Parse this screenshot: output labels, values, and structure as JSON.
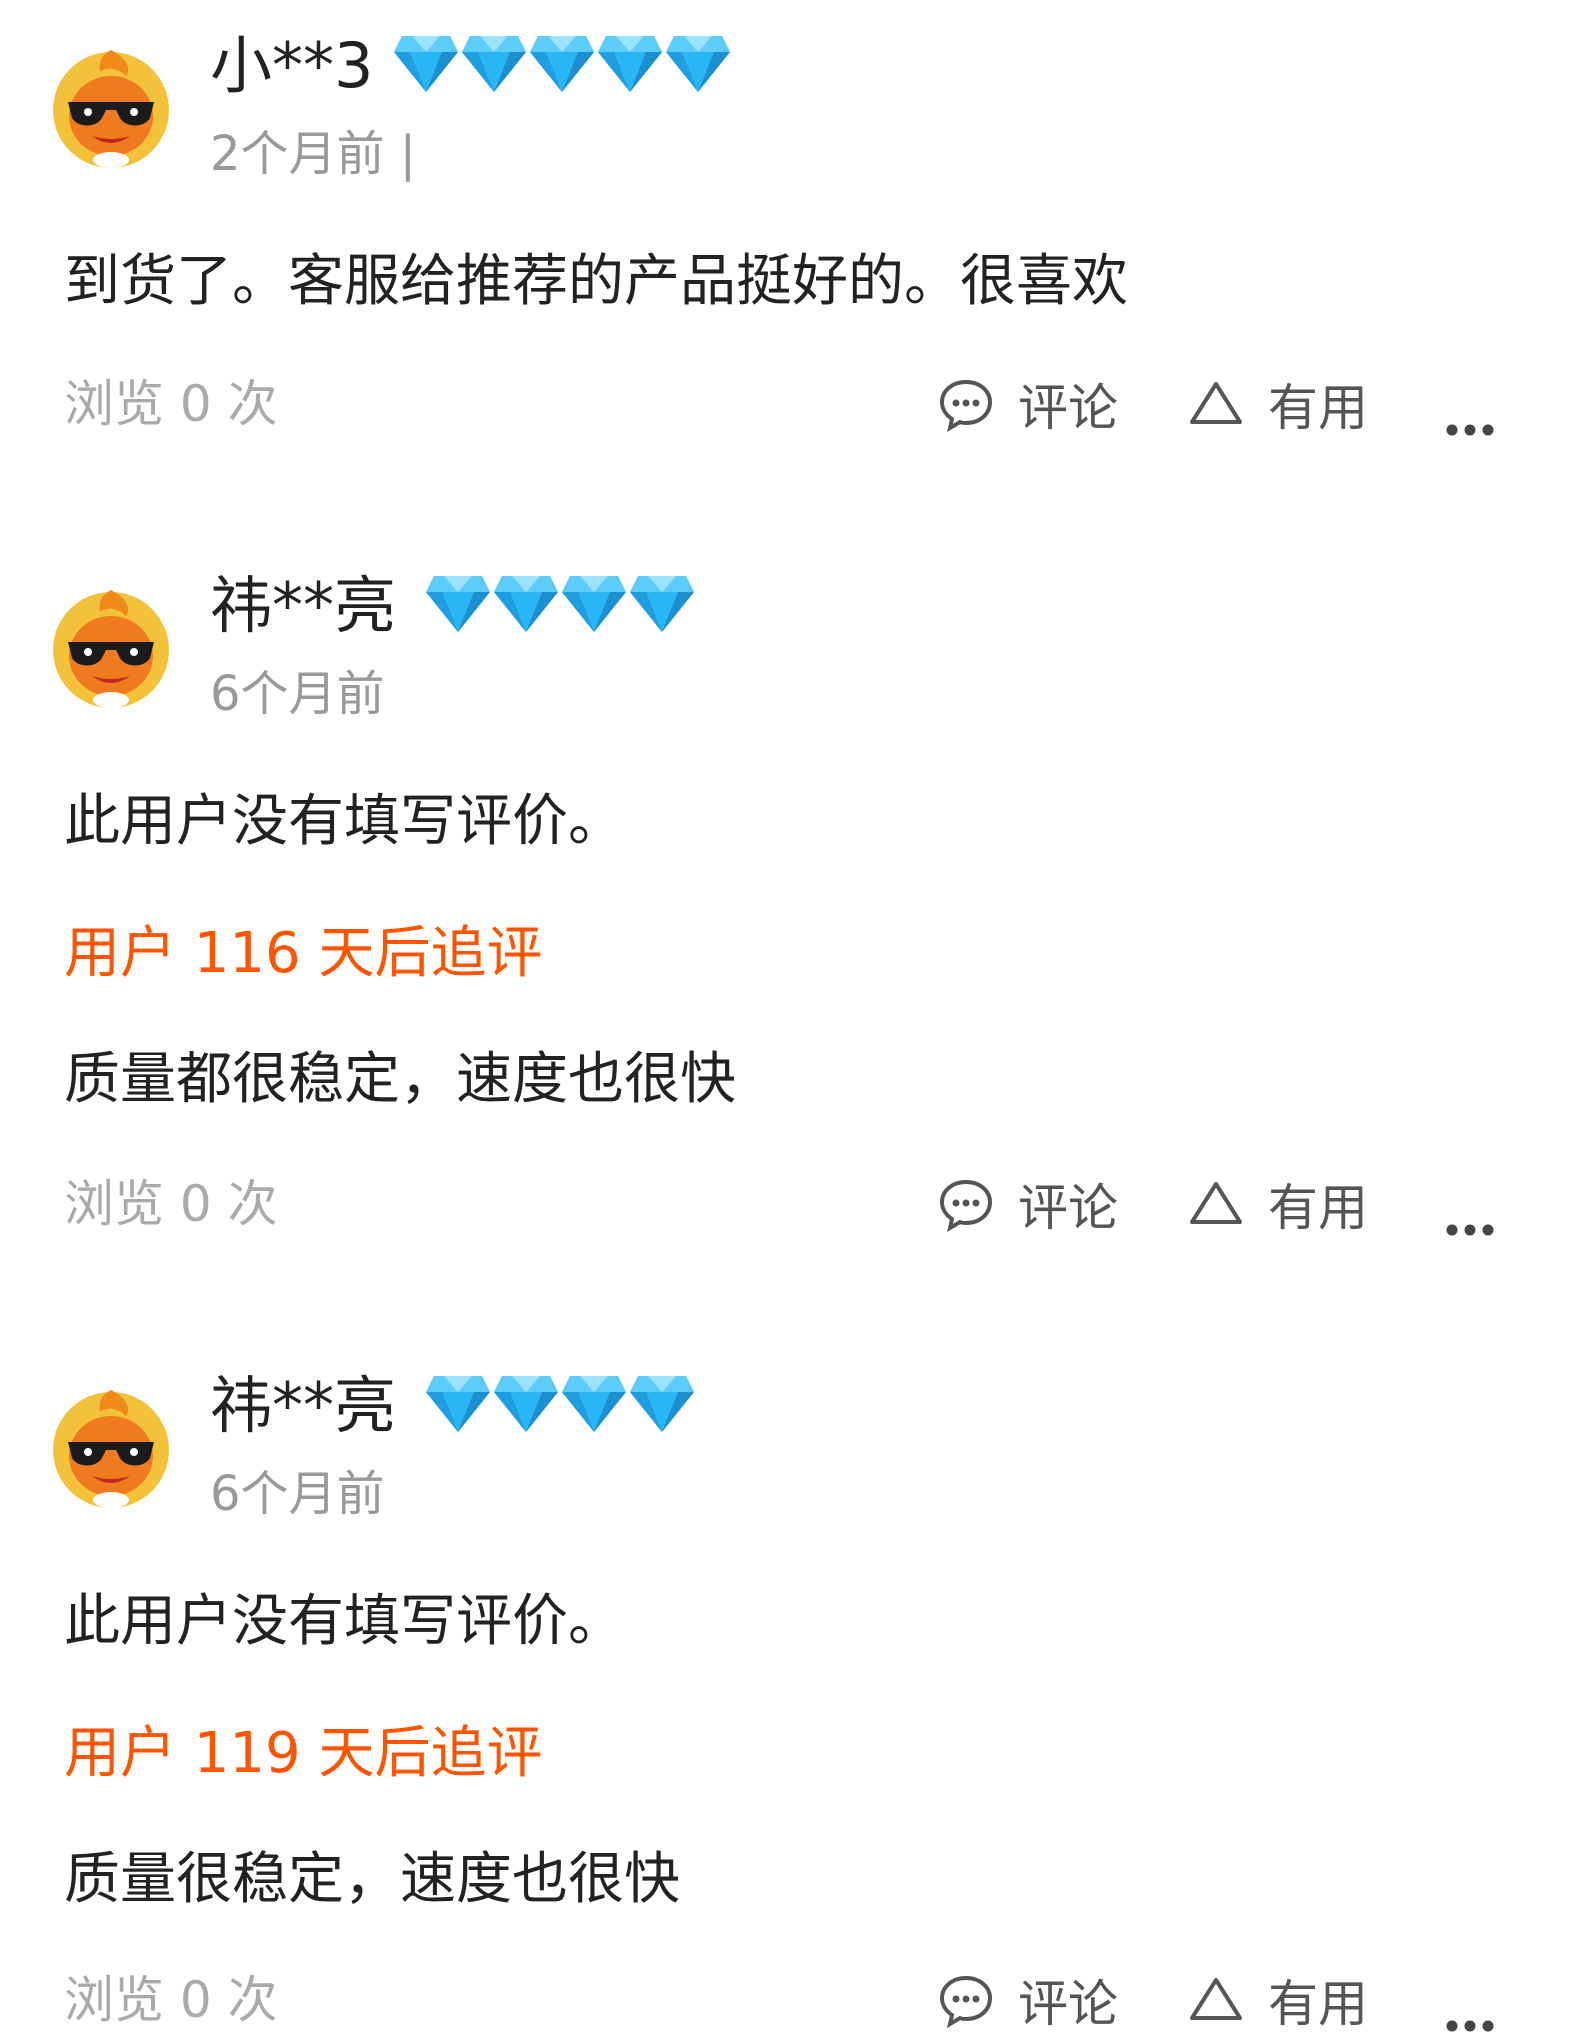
{
  "reviews": [
    {
      "username": "小**3",
      "diamonds": 5,
      "time": "2个月前 |",
      "content": "到货了。客服给推荐的产品挺好的。很喜欢",
      "followup_label": "",
      "followup_text": "",
      "views": "浏览 0 次",
      "comment_label": "评论",
      "useful_label": "有用"
    },
    {
      "username": "祎**亮",
      "diamonds": 4,
      "time": "6个月前",
      "content": "此用户没有填写评价。",
      "followup_label": "用户 116 天后追评",
      "followup_text": "质量都很稳定，速度也很快",
      "views": "浏览 0 次",
      "comment_label": "评论",
      "useful_label": "有用"
    },
    {
      "username": "祎**亮",
      "diamonds": 4,
      "time": "6个月前",
      "content": "此用户没有填写评价。",
      "followup_label": "用户 119 天后追评",
      "followup_text": "质量很稳定，速度也很快",
      "views": "浏览 0 次",
      "comment_label": "评论",
      "useful_label": "有用"
    }
  ],
  "colors": {
    "accent": "#ff5500",
    "diamond": "#29b6f6",
    "muted": "#999999",
    "avatar": "#f59a1c"
  },
  "icons": {
    "avatar": "cartoon-avatar-with-sunglasses",
    "level": "diamond-icon",
    "comment": "comment-bubble-icon",
    "useful": "triangle-up-icon",
    "more": "more-dots-icon"
  }
}
